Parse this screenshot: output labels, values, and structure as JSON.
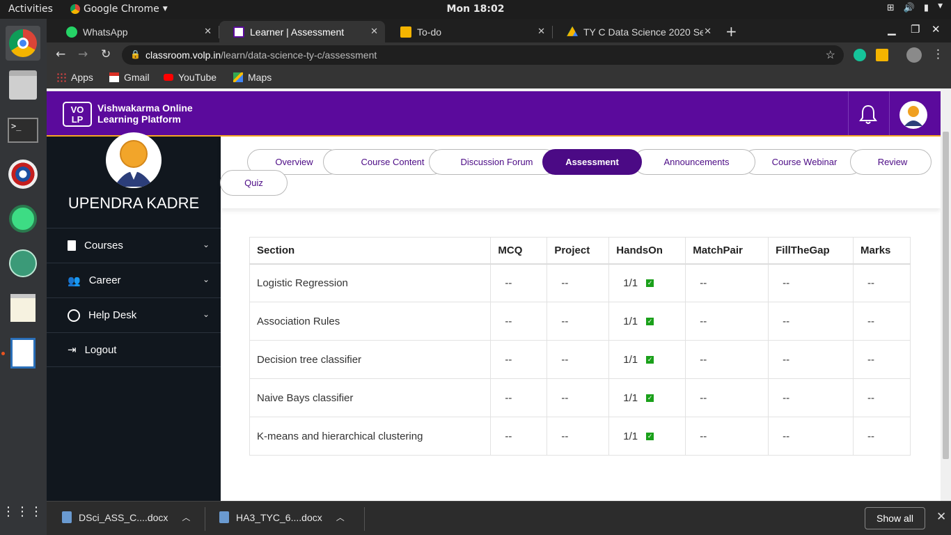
{
  "os": {
    "activities": "Activities",
    "app_menu": "Google Chrome",
    "clock": "Mon 18:02"
  },
  "browser": {
    "tabs": [
      {
        "label": "WhatsApp",
        "active": false
      },
      {
        "label": "Learner | Assessment",
        "active": true
      },
      {
        "label": "To-do",
        "active": false
      },
      {
        "label": "TY C Data Science 2020 Se",
        "active": false
      }
    ],
    "url_host": "classroom.volp.in",
    "url_path": "/learn/data-science-ty-c/assessment",
    "bookmarks": [
      "Apps",
      "Gmail",
      "YouTube",
      "Maps"
    ]
  },
  "site": {
    "logo_line1": "VO",
    "logo_line2": "LP",
    "brand_line1": "Vishwakarma Online",
    "brand_line2": "Learning Platform",
    "brand_color": "#5b0a9c"
  },
  "sidebar": {
    "user_name": "UPENDRA KADRE",
    "items": [
      {
        "label": "Courses",
        "icon": "book-icon",
        "has_chevron": true
      },
      {
        "label": "Career",
        "icon": "users-icon",
        "has_chevron": true
      },
      {
        "label": "Help Desk",
        "icon": "user-circle-icon",
        "has_chevron": true
      },
      {
        "label": "Logout",
        "icon": "logout-icon",
        "has_chevron": false
      }
    ]
  },
  "course_tabs": [
    {
      "label": "Overview",
      "active": false
    },
    {
      "label": "Course Content",
      "active": false
    },
    {
      "label": "Discussion Forum",
      "active": false
    },
    {
      "label": "Assessment",
      "active": true
    },
    {
      "label": "Announcements",
      "active": false
    },
    {
      "label": "Course Webinar",
      "active": false
    },
    {
      "label": "Review",
      "active": false
    },
    {
      "label": "Quiz",
      "active": false
    }
  ],
  "assessment_table": {
    "headers": [
      "Section",
      "MCQ",
      "Project",
      "HandsOn",
      "MatchPair",
      "FillTheGap",
      "Marks"
    ],
    "rows": [
      {
        "section": "Logistic Regression",
        "mcq": "--",
        "project": "--",
        "handson": "1/1",
        "matchpair": "--",
        "fillthegap": "--",
        "marks": "--"
      },
      {
        "section": "Association Rules",
        "mcq": "--",
        "project": "--",
        "handson": "1/1",
        "matchpair": "--",
        "fillthegap": "--",
        "marks": "--"
      },
      {
        "section": "Decision tree classifier",
        "mcq": "--",
        "project": "--",
        "handson": "1/1",
        "matchpair": "--",
        "fillthegap": "--",
        "marks": "--"
      },
      {
        "section": "Naive Bays classifier",
        "mcq": "--",
        "project": "--",
        "handson": "1/1",
        "matchpair": "--",
        "fillthegap": "--",
        "marks": "--"
      },
      {
        "section": "K-means and hierarchical clustering",
        "mcq": "--",
        "project": "--",
        "handson": "1/1",
        "matchpair": "--",
        "fillthegap": "--",
        "marks": "--"
      }
    ]
  },
  "downloads": {
    "items": [
      "DSci_ASS_C....docx",
      "HA3_TYC_6....docx"
    ],
    "show_all": "Show all"
  }
}
